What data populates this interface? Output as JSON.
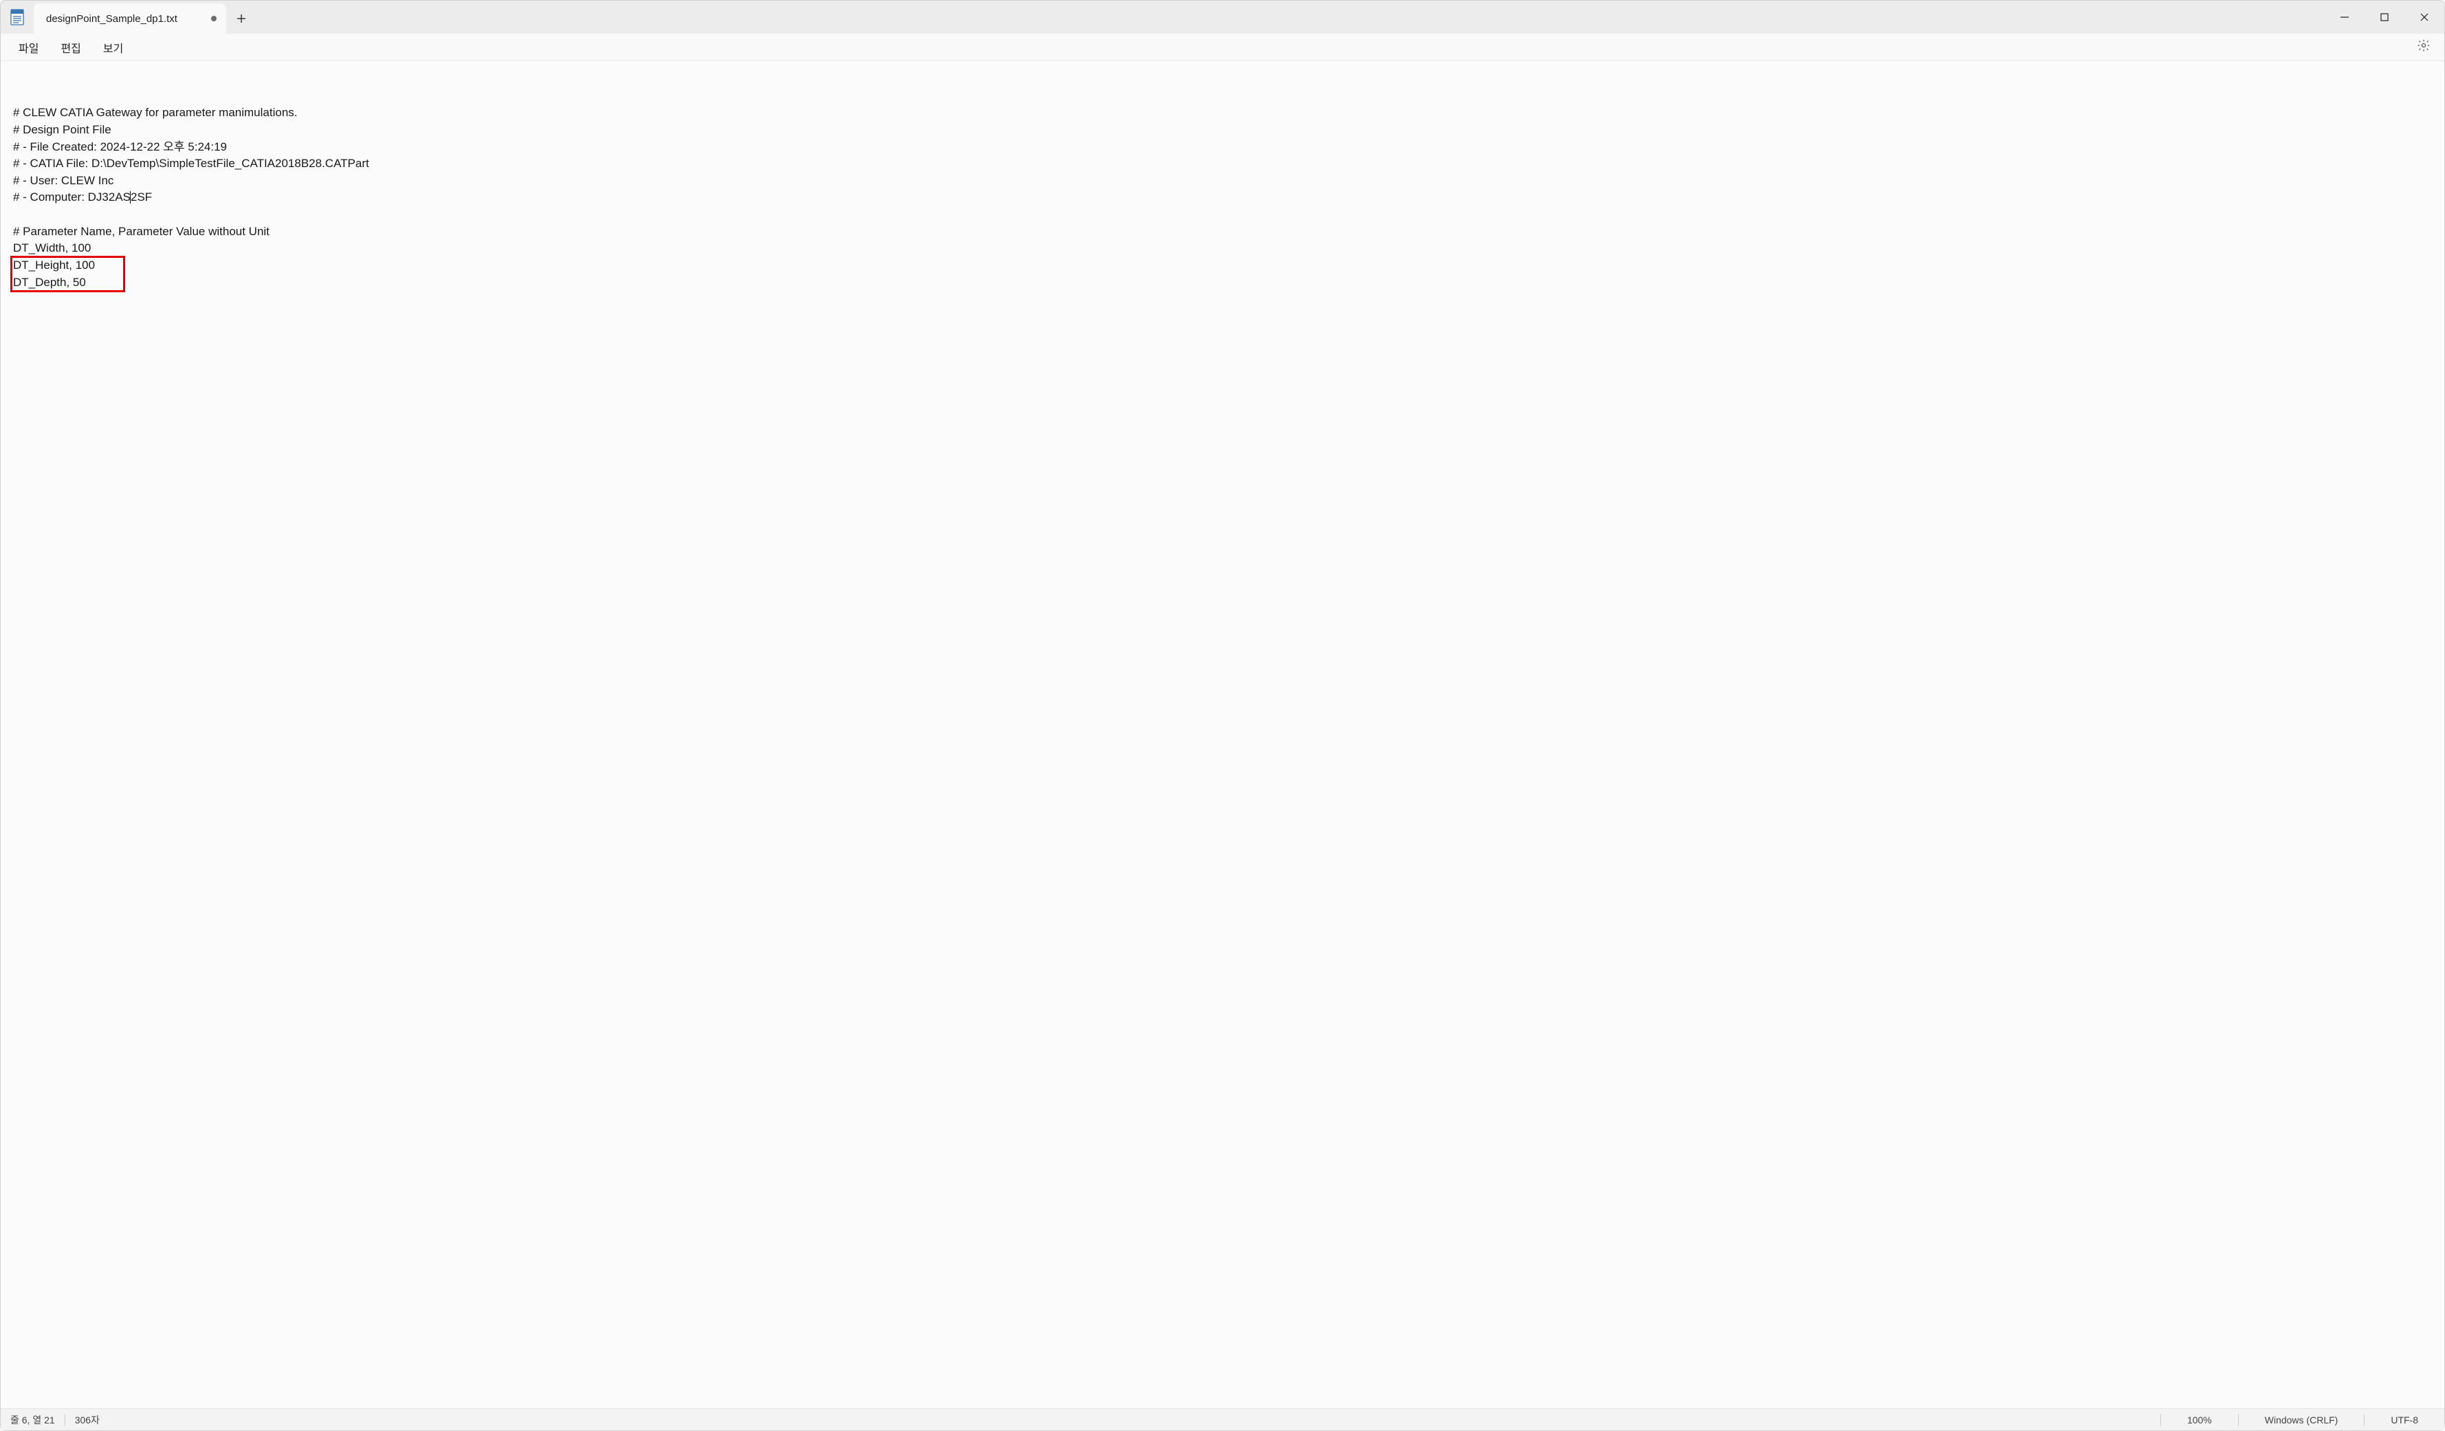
{
  "titlebar": {
    "tab_title": "designPoint_Sample_dp1.txt",
    "modified": true
  },
  "menu": {
    "file": "파일",
    "edit": "편집",
    "view": "보기"
  },
  "editor": {
    "lines": [
      "# CLEW CATIA Gateway for parameter manimulations.",
      "# Design Point File",
      "# - File Created: 2024-12-22 오후 5:24:19",
      "# - CATIA File: D:\\DevTemp\\SimpleTestFile_CATIA2018B28.CATPart",
      "# - User: CLEW Inc",
      "# - Computer: DJ32AS2SF",
      "",
      "# Parameter Name, Parameter Value without Unit",
      "DT_Width, 100",
      "DT_Height, 100",
      "DT_Depth, 50"
    ],
    "caret_line_index": 5,
    "caret_before": "# - Computer: DJ32AS",
    "caret_after": "2SF",
    "highlight_start_line": 9,
    "highlight_end_line": 10
  },
  "statusbar": {
    "position": "줄 6, 열 21",
    "chars": "306자",
    "zoom": "100%",
    "line_ending": "Windows (CRLF)",
    "encoding": "UTF-8"
  }
}
